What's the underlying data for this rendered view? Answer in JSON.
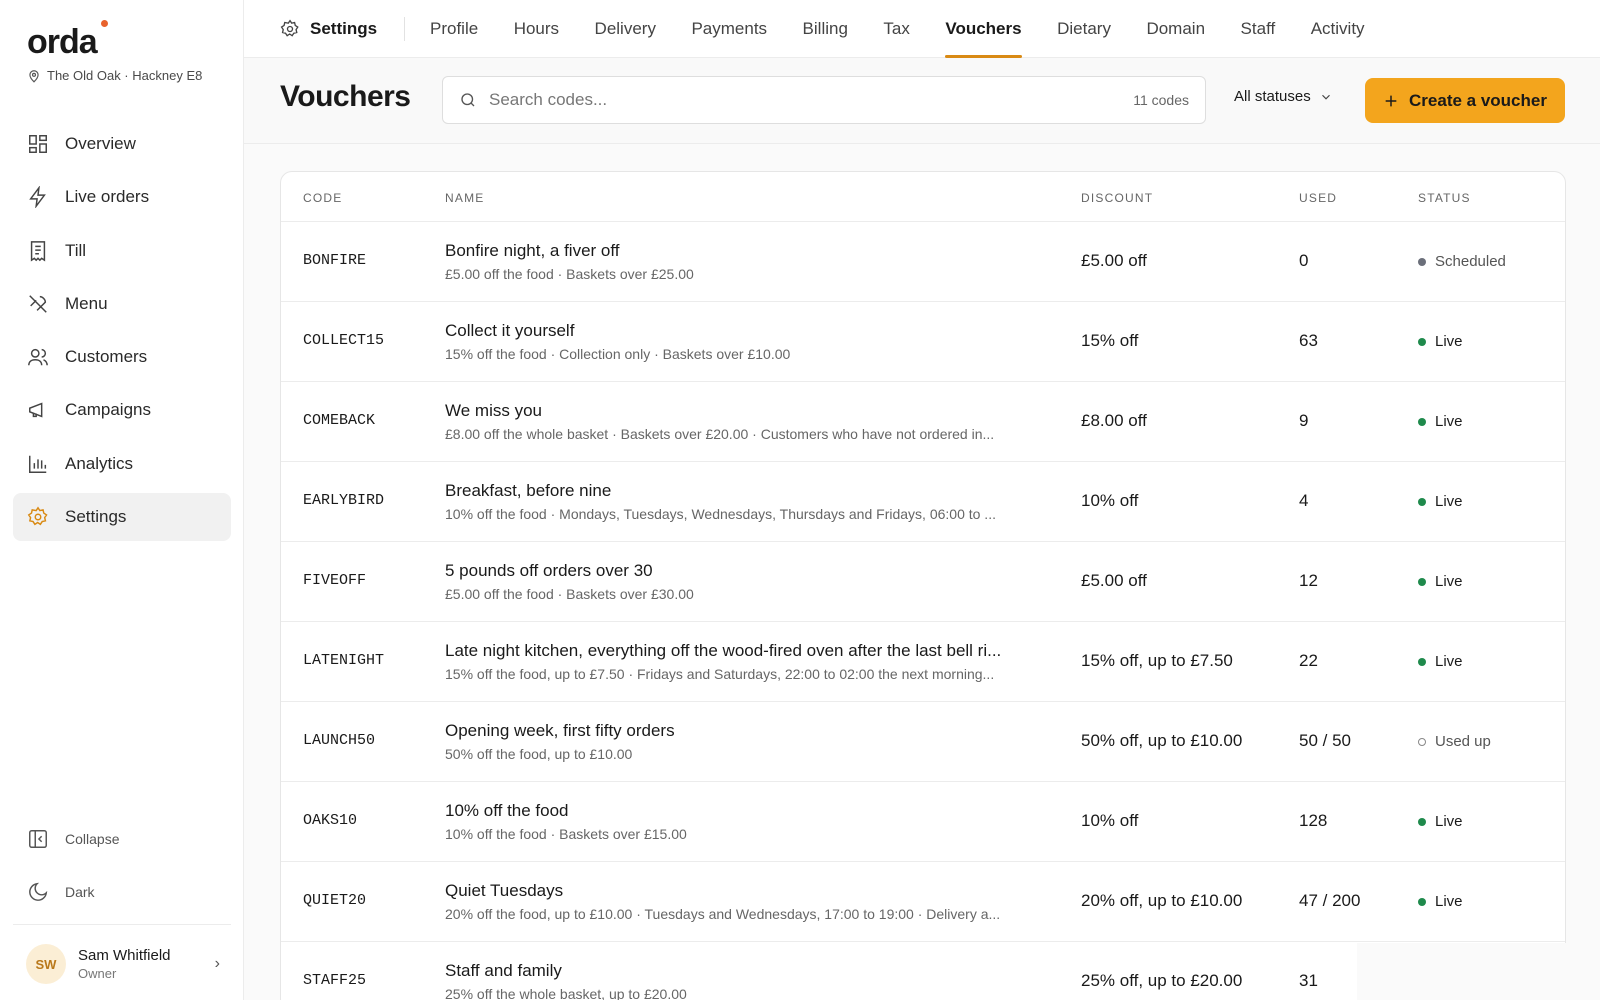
{
  "brand": {
    "name": "orda",
    "location": "The Old Oak · Hackney E8"
  },
  "nav": [
    {
      "label": "Overview",
      "icon": "grid-icon"
    },
    {
      "label": "Live orders",
      "icon": "bolt-icon"
    },
    {
      "label": "Till",
      "icon": "receipt-icon"
    },
    {
      "label": "Menu",
      "icon": "utensils-icon"
    },
    {
      "label": "Customers",
      "icon": "users-icon"
    },
    {
      "label": "Campaigns",
      "icon": "megaphone-icon"
    },
    {
      "label": "Analytics",
      "icon": "bar-chart-icon"
    },
    {
      "label": "Settings",
      "icon": "gear-icon",
      "active": true
    }
  ],
  "sidebar_bottom": {
    "collapse_label": "Collapse",
    "dark_label": "Dark"
  },
  "user": {
    "initials": "SW",
    "name": "Sam Whitfield",
    "role": "Owner"
  },
  "topbar": {
    "settings_label": "Settings",
    "tabs": [
      "Profile",
      "Hours",
      "Delivery",
      "Payments",
      "Billing",
      "Tax",
      "Vouchers",
      "Dietary",
      "Domain",
      "Staff",
      "Activity"
    ],
    "active_tab": "Vouchers"
  },
  "header": {
    "title": "Vouchers",
    "search_placeholder": "Search codes...",
    "search_count": "11 codes",
    "status_filter": "All statuses",
    "create_label": "Create a voucher"
  },
  "table": {
    "columns": {
      "code": "CODE",
      "name": "NAME",
      "discount": "DISCOUNT",
      "used": "USED",
      "status": "STATUS"
    },
    "rows": [
      {
        "code": "BONFIRE",
        "name": "Bonfire night, a fiver off",
        "detail": "£5.00 off the food · Baskets over £25.00",
        "discount": "£5.00 off",
        "used": "0",
        "status": "Scheduled",
        "status_kind": "sched"
      },
      {
        "code": "COLLECT15",
        "name": "Collect it yourself",
        "detail": "15% off the food · Collection only · Baskets over £10.00",
        "discount": "15% off",
        "used": "63",
        "status": "Live",
        "status_kind": "live"
      },
      {
        "code": "COMEBACK",
        "name": "We miss you",
        "detail": "£8.00 off the whole basket · Baskets over £20.00 · Customers who have not ordered in...",
        "discount": "£8.00 off",
        "used": "9",
        "status": "Live",
        "status_kind": "live"
      },
      {
        "code": "EARLYBIRD",
        "name": "Breakfast, before nine",
        "detail": "10% off the food · Mondays, Tuesdays, Wednesdays, Thursdays and Fridays, 06:00 to ...",
        "discount": "10% off",
        "used": "4",
        "status": "Live",
        "status_kind": "live"
      },
      {
        "code": "FIVEOFF",
        "name": "5 pounds off orders over 30",
        "detail": "£5.00 off the food · Baskets over £30.00",
        "discount": "£5.00 off",
        "used": "12",
        "status": "Live",
        "status_kind": "live"
      },
      {
        "code": "LATENIGHT",
        "name": "Late night kitchen, everything off the wood-fired oven after the last bell ri...",
        "detail": "15% off the food, up to £7.50 · Fridays and Saturdays, 22:00 to 02:00 the next morning...",
        "discount": "15% off, up to £7.50",
        "used": "22",
        "status": "Live",
        "status_kind": "live"
      },
      {
        "code": "LAUNCH50",
        "name": "Opening week, first fifty orders",
        "detail": "50% off the food, up to £10.00",
        "discount": "50% off, up to £10.00",
        "used": "50 / 50",
        "status": "Used up",
        "status_kind": "used"
      },
      {
        "code": "OAKS10",
        "name": "10% off the food",
        "detail": "10% off the food · Baskets over £15.00",
        "discount": "10% off",
        "used": "128",
        "status": "Live",
        "status_kind": "live"
      },
      {
        "code": "QUIET20",
        "name": "Quiet Tuesdays",
        "detail": "20% off the food, up to £10.00 · Tuesdays and Wednesdays, 17:00 to 19:00 · Delivery a...",
        "discount": "20% off, up to £10.00",
        "used": "47 / 200",
        "status": "Live",
        "status_kind": "live"
      },
      {
        "code": "STAFF25",
        "name": "Staff and family",
        "detail": "25% off the whole basket, up to £20.00",
        "discount": "25% off, up to £20.00",
        "used": "31",
        "status": "",
        "status_kind": ""
      }
    ]
  },
  "colors": {
    "accent": "#f3a51d",
    "live": "#1f8a4c",
    "brand_dot": "#e8622c"
  }
}
